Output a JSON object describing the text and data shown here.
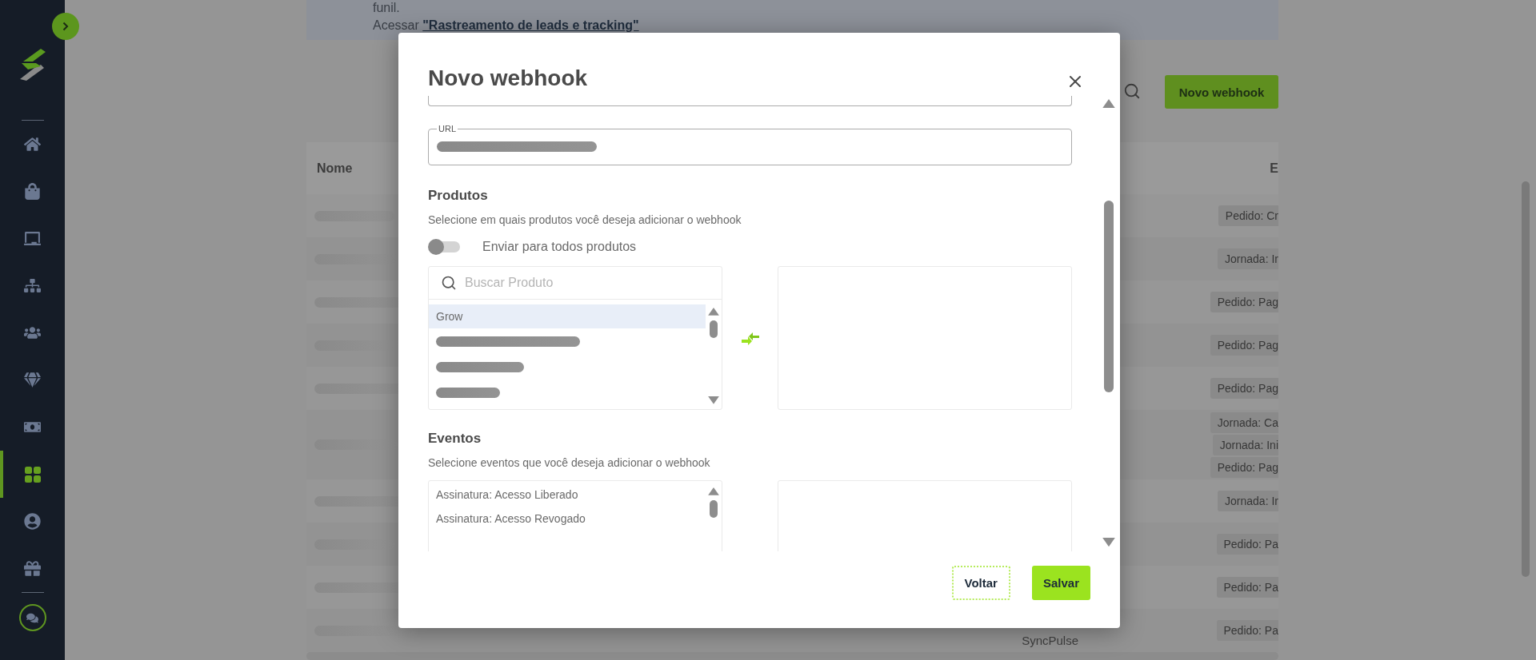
{
  "sidebar": {
    "items": [
      {
        "kind": "home",
        "selected": false
      },
      {
        "kind": "bag",
        "selected": false
      },
      {
        "kind": "presentation",
        "selected": false
      },
      {
        "kind": "network",
        "selected": false
      },
      {
        "kind": "users",
        "selected": false
      },
      {
        "kind": "gem",
        "selected": false
      },
      {
        "kind": "money",
        "selected": false
      },
      {
        "kind": "grid",
        "selected": true
      },
      {
        "kind": "user",
        "selected": false
      },
      {
        "kind": "gift",
        "selected": false
      }
    ],
    "footer_items": [
      {
        "kind": "chat",
        "selected": false
      }
    ]
  },
  "banner": {
    "line_1": "funil.",
    "link_prefix": "Acessar",
    "link": "\"Rastreamento de leads e tracking\""
  },
  "toolbar": {
    "button": "Novo webhook"
  },
  "table": {
    "columns": [
      {
        "label": "Nome"
      },
      {
        "label": "E"
      }
    ],
    "rows": [
      {
        "events": [
          "Pedido: Cr"
        ]
      },
      {
        "events": [
          "Jornada: Ir"
        ]
      },
      {
        "events": [
          "Pedido: Pag"
        ]
      },
      {
        "events": [
          "Pedido: Pag"
        ]
      },
      {
        "events": [
          "Pedido: Pag"
        ]
      },
      {
        "events": [
          "Jornada: Ca",
          "Jornada: Ini",
          "Pedido: Pag"
        ]
      },
      {
        "events": [
          "Jornada: Ir"
        ]
      },
      {
        "events": [
          "Pedido: Pa"
        ]
      },
      {
        "events": [
          "Pedido: Pa"
        ]
      },
      {
        "column_3": "SyncPulse",
        "events": [
          "Pedido: Pa"
        ]
      }
    ]
  },
  "modal": {
    "title": "Novo webhook",
    "url_field": {
      "label": "URL"
    },
    "products": {
      "heading": "Produtos",
      "description": "Selecione em quais produtos você deseja adicionar o webhook",
      "toggle": {
        "label": "Enviar para todos produtos",
        "on": false
      },
      "search": {
        "placeholder": "Buscar Produto"
      },
      "items": [
        {
          "label": "Grow",
          "selected": true
        },
        {
          "selected": false
        },
        {
          "selected": false
        },
        {
          "selected": false
        }
      ]
    },
    "events": {
      "heading": "Eventos",
      "description": "Selecione eventos que você deseja adicionar o webhook",
      "items": [
        {
          "label": "Assinatura: Acesso Liberado",
          "selected": false
        },
        {
          "label": "Assinatura: Acesso Revogado",
          "selected": false
        }
      ]
    },
    "buttons": [
      {
        "label": "Voltar",
        "kind": "secondary"
      },
      {
        "label": "Salvar",
        "kind": "primary"
      }
    ]
  }
}
